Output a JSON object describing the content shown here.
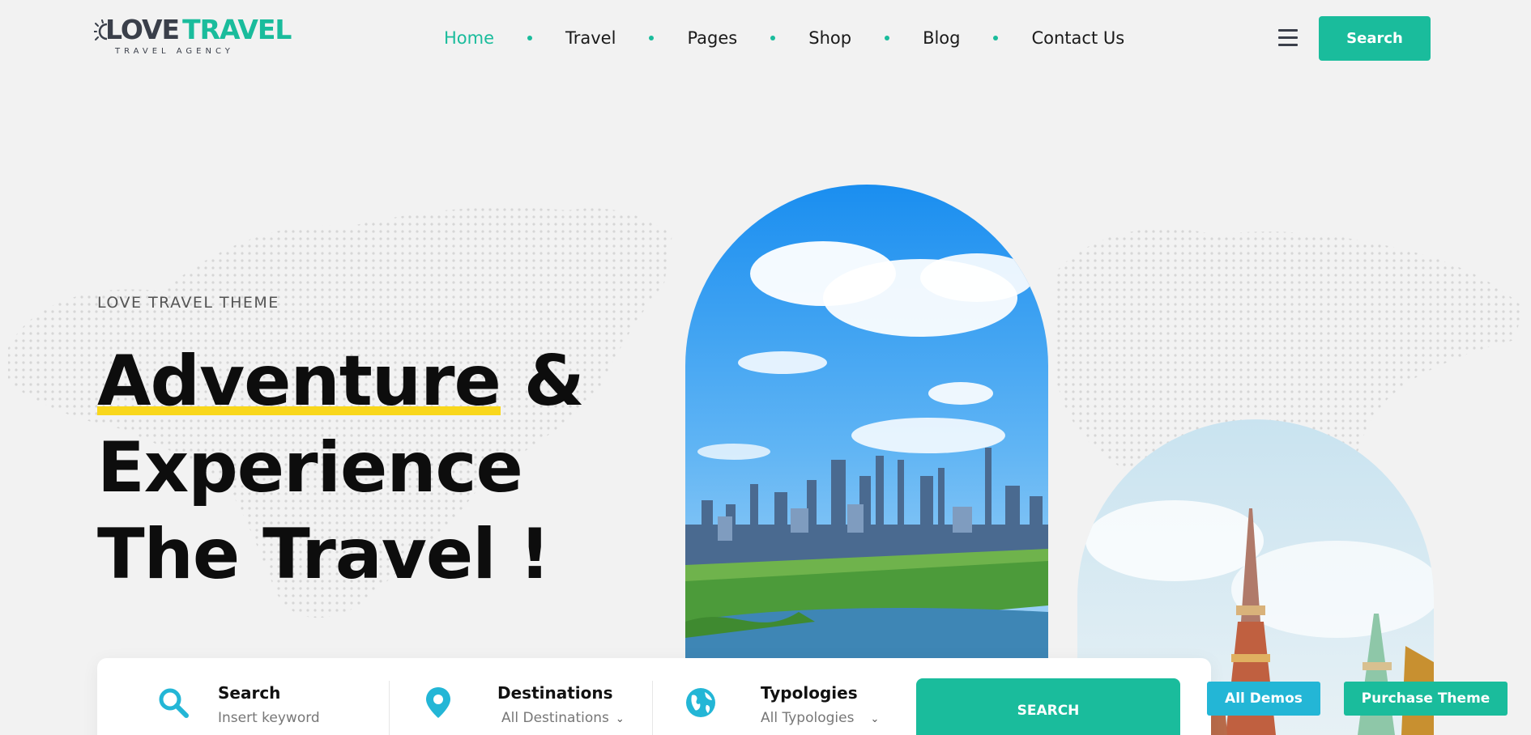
{
  "logo": {
    "word1": "LOVE",
    "word2": "TRAVEL",
    "tagline": "TRAVEL AGENCY"
  },
  "nav": {
    "items": [
      {
        "label": "Home",
        "active": true
      },
      {
        "label": "Travel"
      },
      {
        "label": "Pages"
      },
      {
        "label": "Shop"
      },
      {
        "label": "Blog"
      },
      {
        "label": "Contact Us"
      }
    ]
  },
  "header": {
    "menu_icon": "hamburger-icon",
    "search_label": "Search"
  },
  "hero": {
    "eyebrow": "LOVE TRAVEL THEME",
    "headline_word1": "Adventure",
    "headline_amp": " &",
    "headline_line2": "Experience",
    "headline_line3": "The Travel !"
  },
  "searchbar": {
    "search_title": "Search",
    "search_placeholder": "Insert keyword",
    "destinations_title": "Destinations",
    "destinations_value": "All Destinations",
    "typologies_title": "Typologies",
    "typologies_value": "All Typologies",
    "submit_label": "SEARCH"
  },
  "floating": {
    "demos_label": "All Demos",
    "purchase_label": "Purchase Theme"
  },
  "colors": {
    "accent": "#1abc9c",
    "highlight": "#f9d71c",
    "demos": "#23b6d6"
  }
}
